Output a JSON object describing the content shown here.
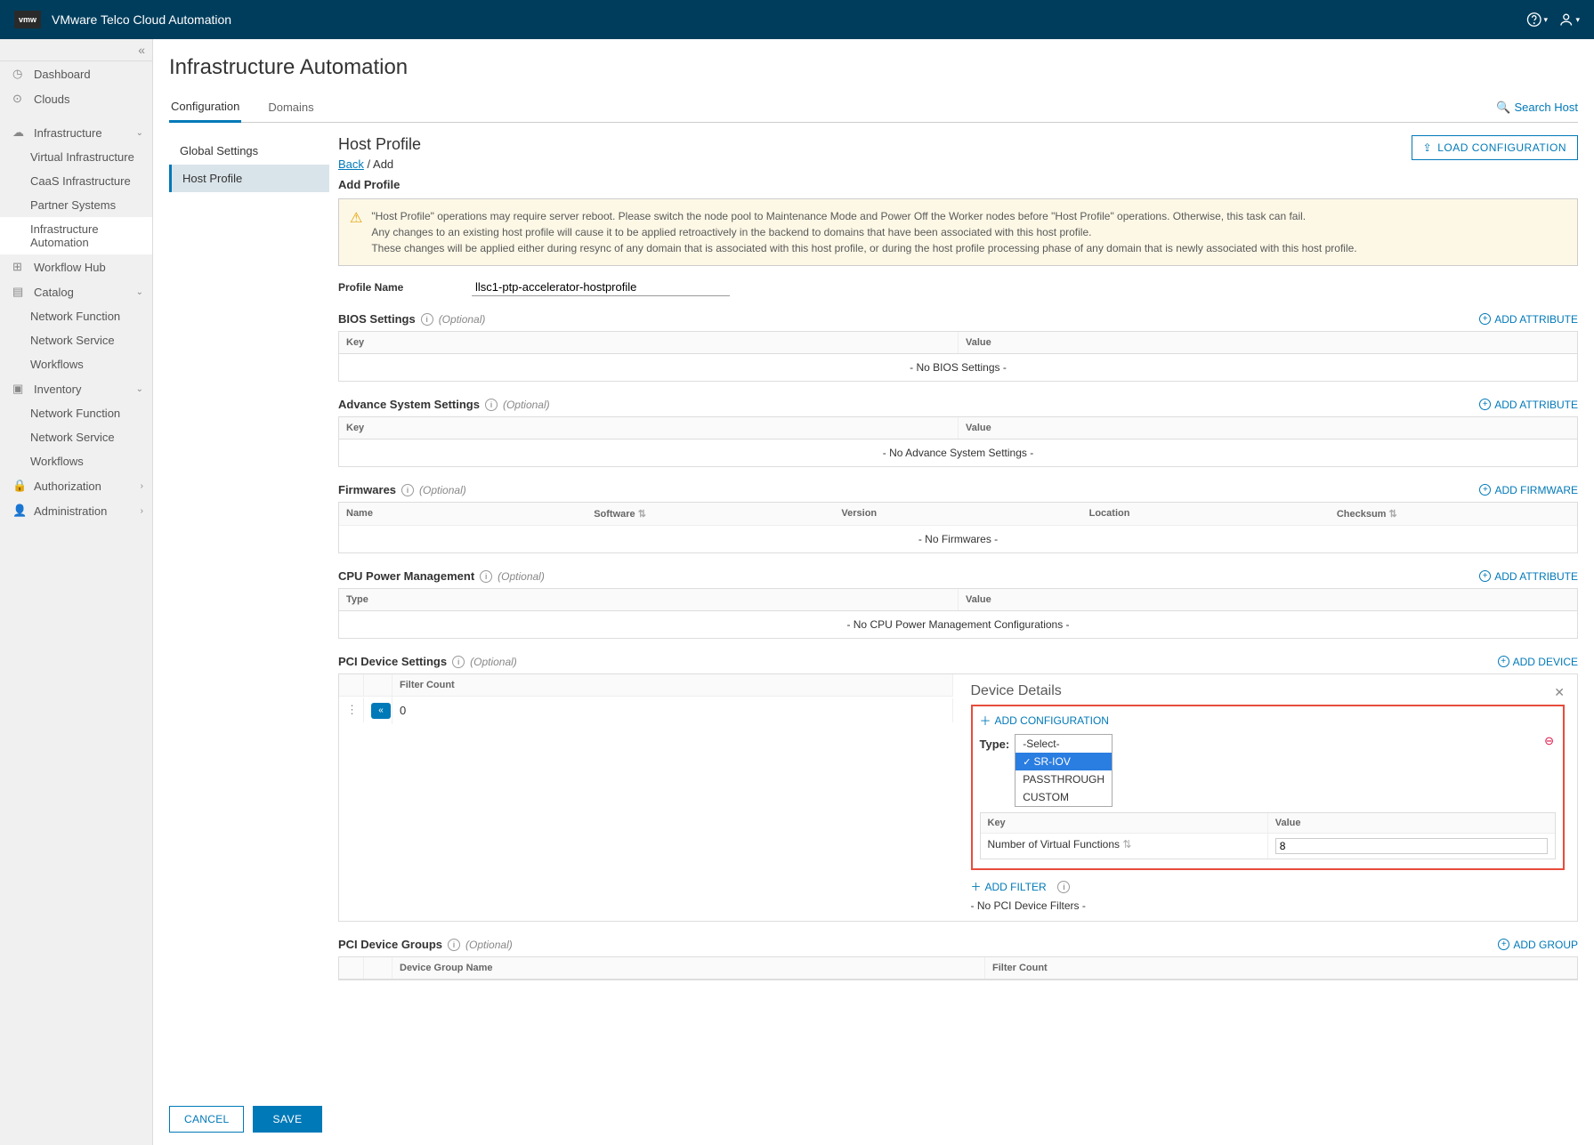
{
  "top": {
    "title": "VMware Telco Cloud Automation"
  },
  "sidebar": {
    "items": [
      {
        "label": "Dashboard",
        "icon": "⌂"
      },
      {
        "label": "Clouds",
        "icon": "⊙"
      },
      {
        "label": "Infrastructure",
        "icon": "☁",
        "expandable": true
      },
      {
        "label": "Virtual Infrastructure",
        "sub": true
      },
      {
        "label": "CaaS Infrastructure",
        "sub": true
      },
      {
        "label": "Partner Systems",
        "sub": true
      },
      {
        "label": "Infrastructure Automation",
        "sub": true,
        "active": true
      },
      {
        "label": "Workflow Hub",
        "icon": "⊞"
      },
      {
        "label": "Catalog",
        "icon": "▤",
        "expandable": true
      },
      {
        "label": "Network Function",
        "sub": true
      },
      {
        "label": "Network Service",
        "sub": true
      },
      {
        "label": "Workflows",
        "sub": true
      },
      {
        "label": "Inventory",
        "icon": "▣",
        "expandable": true
      },
      {
        "label": "Network Function",
        "sub": true
      },
      {
        "label": "Network Service",
        "sub": true
      },
      {
        "label": "Workflows",
        "sub": true
      },
      {
        "label": "Authorization",
        "icon": "🔒",
        "expandable": true,
        "caret": "›"
      },
      {
        "label": "Administration",
        "icon": "👤",
        "expandable": true,
        "caret": "›"
      }
    ]
  },
  "page": {
    "title": "Infrastructure Automation",
    "tabs": [
      {
        "label": "Configuration",
        "active": true
      },
      {
        "label": "Domains"
      }
    ],
    "search_host": "Search Host",
    "subnav": [
      {
        "label": "Global Settings"
      },
      {
        "label": "Host Profile",
        "active": true
      }
    ]
  },
  "hp": {
    "title": "Host Profile",
    "crumb_back": "Back",
    "crumb_add": "Add",
    "load_btn": "LOAD CONFIGURATION",
    "add_profile": "Add Profile",
    "warn": "\"Host Profile\" operations may require server reboot. Please switch the node pool to Maintenance Mode and Power Off the Worker nodes before \"Host Profile\" operations. Otherwise, this task can fail.\nAny changes to an existing host profile will cause it to be applied retroactively in the backend to domains that have been associated with this host profile.\nThese changes will be applied either during resync of any domain that is associated with this host profile, or during the host profile processing phase of any domain that is newly associated with this host profile.",
    "profile_label": "Profile Name",
    "profile_value": "llsc1-ptp-accelerator-hostprofile"
  },
  "sections": {
    "optional": "(Optional)",
    "add_attribute": "ADD ATTRIBUTE",
    "add_firmware": "ADD FIRMWARE",
    "add_device": "ADD DEVICE",
    "add_group": "ADD GROUP",
    "key": "Key",
    "value": "Value",
    "bios": {
      "title": "BIOS Settings",
      "empty": "- No BIOS Settings -"
    },
    "adv": {
      "title": "Advance System Settings",
      "empty": "- No Advance System Settings -"
    },
    "fw": {
      "title": "Firmwares",
      "empty": "- No Firmwares -",
      "cols": [
        "Name",
        "Software",
        "Version",
        "Location",
        "Checksum"
      ]
    },
    "cpu": {
      "title": "CPU Power Management",
      "empty": "- No CPU Power Management Configurations -",
      "type": "Type"
    },
    "pci": {
      "title": "PCI Device Settings",
      "filter_count": "Filter Count",
      "count": "0"
    },
    "pcg": {
      "title": "PCI Device Groups",
      "dgn": "Device Group Name",
      "fc": "Filter Count"
    }
  },
  "dd": {
    "title": "Device Details",
    "add_conf": "ADD CONFIGURATION",
    "type_label": "Type:",
    "options": [
      "-Select-",
      "SR-IOV",
      "PASSTHROUGH",
      "CUSTOM"
    ],
    "key": "Key",
    "value": "Value",
    "nvf_label": "Number of Virtual Functions",
    "nvf_value": "8",
    "add_filter": "ADD FILTER",
    "no_filters": "- No PCI Device Filters -"
  },
  "footer": {
    "cancel": "CANCEL",
    "save": "SAVE"
  }
}
